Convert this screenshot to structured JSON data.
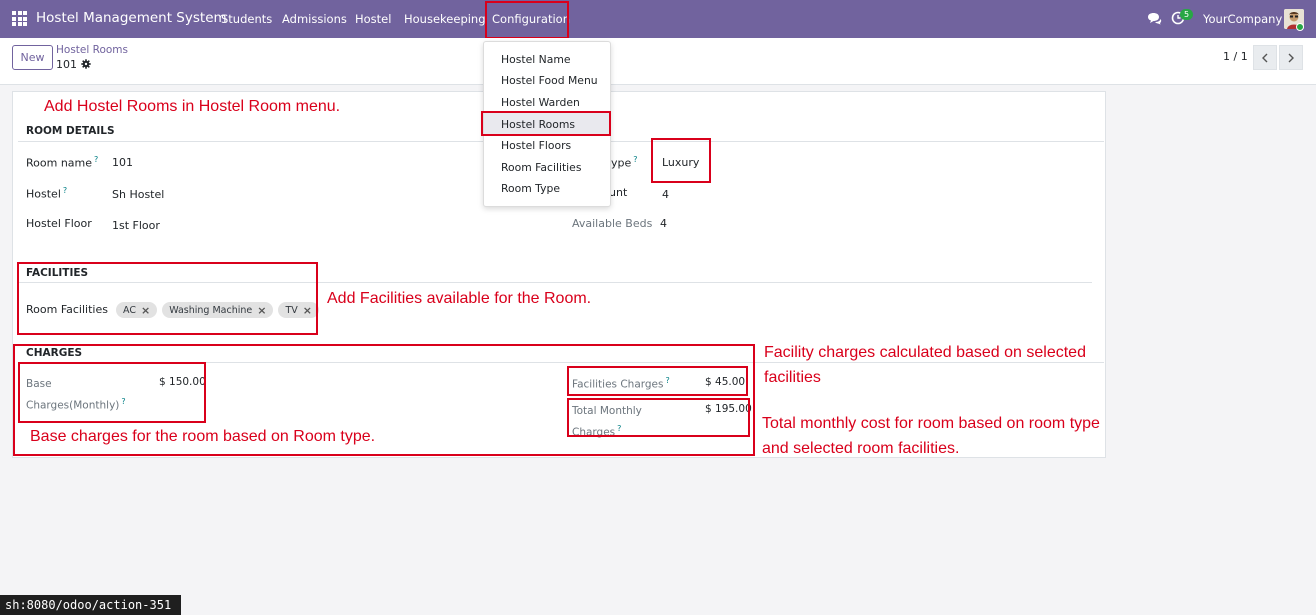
{
  "navbar": {
    "brand": "Hostel Management System",
    "menus": [
      "Students",
      "Admissions",
      "Hostel",
      "Housekeeping",
      "Configuration"
    ],
    "activity_count": "5",
    "company": "YourCompany",
    "bg_color": "#71639e"
  },
  "control": {
    "new_label": "New",
    "breadcrumb_parent": "Hostel Rooms",
    "breadcrumb_current": "101",
    "pager": "1 / 1"
  },
  "dropdown": {
    "items": [
      "Hostel Name",
      "Hostel Food Menu",
      "Hostel Warden",
      "Hostel Rooms",
      "Hostel Floors",
      "Room Facilities",
      "Room Type"
    ],
    "active": "Hostel Rooms"
  },
  "form": {
    "room_details_title": "ROOM DETAILS",
    "room_name_label": "Room name",
    "room_name_value": "101",
    "hostel_label": "Hostel",
    "hostel_value": "Sh Hostel",
    "hostel_floor_label": "Hostel Floor",
    "hostel_floor_value": "1st Floor",
    "room_type_label_partial": "ype",
    "room_type_value": "Luxury",
    "bed_count_label_partial": "unt",
    "bed_count_value": "4",
    "available_beds_label": "Available Beds",
    "available_beds_value": "4",
    "facilities_title": "FACILITIES",
    "room_facilities_label": "Room Facilities",
    "facility_tags": [
      "AC",
      "Washing Machine",
      "TV"
    ],
    "charges_title": "CHARGES",
    "base_charges_label_line1": "Base",
    "base_charges_label_line2": "Charges(Monthly)",
    "base_charges_value": "$ 150.00",
    "facilities_charges_label": "Facilities Charges",
    "facilities_charges_value": "$ 45.00",
    "total_monthly_label_line1": "Total Monthly",
    "total_monthly_label_line2": "Charges",
    "total_monthly_value": "$ 195.00"
  },
  "annotations": {
    "add_rooms": "Add Hostel Rooms in Hostel Room menu.",
    "add_facilities": "Add Facilities available for the Room.",
    "facility_charges_line1": "Facility charges calculated based on selected",
    "facility_charges_line2": "facilities",
    "total_cost_line1": "Total monthly cost for room based on room type",
    "total_cost_line2": "and selected room facilities.",
    "base_charges": "Base charges for the room based on Room type.",
    "color": "#d9001b"
  },
  "status_url": "sh:8080/odoo/action-351"
}
